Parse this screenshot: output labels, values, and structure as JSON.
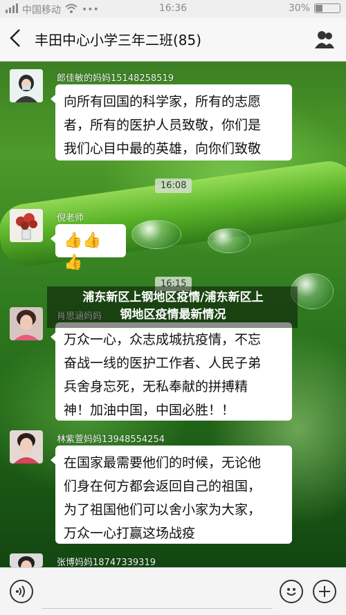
{
  "status_bar": {
    "carrier": "中国移动",
    "time": "16:36",
    "battery": "30%",
    "battery_level": 0.3
  },
  "header": {
    "title": "丰田中心小学三年二班(85)",
    "back_icon": "chevron-left-icon",
    "people_icon": "group-icon"
  },
  "messages": [
    {
      "sender": "郎佳敏的妈妈15148258519",
      "lines": [
        "向所有回国的科学家，所有的志愿",
        "者，所有的医护人员致敬，你们是",
        "我们心目中最的英雄，向你们致敬"
      ]
    },
    {
      "timestamp": "16:08"
    },
    {
      "sender": "倪老师",
      "content": "👍👍👍"
    },
    {
      "timestamp": "16:15"
    },
    {
      "sender": "肖思涵妈妈",
      "lines": [
        "万众一心，众志成城抗疫情，不忘",
        "奋战一线的医护工作者、人民子弟",
        "兵舍身忘死，无私奉献的拼搏精",
        "神！加油中国，中国必胜！！"
      ]
    },
    {
      "sender": "林紫萱妈妈13948554254",
      "lines": [
        "在国家最需要他们的时候，无论他",
        "们身在何方都会返回自己的祖国，",
        "为了祖国他们可以舍小家为大家，",
        "万众一心打赢这场战疫"
      ]
    },
    {
      "sender": "张博妈妈18747339319"
    }
  ],
  "overlay": {
    "line1": "浦东新区上钢地区疫情/浦东新区上",
    "line2": "钢地区疫情最新情况"
  },
  "input_bar": {
    "voice_icon": "voice-icon",
    "emoji_icon": "emoji-icon",
    "add_icon": "plus-icon"
  }
}
